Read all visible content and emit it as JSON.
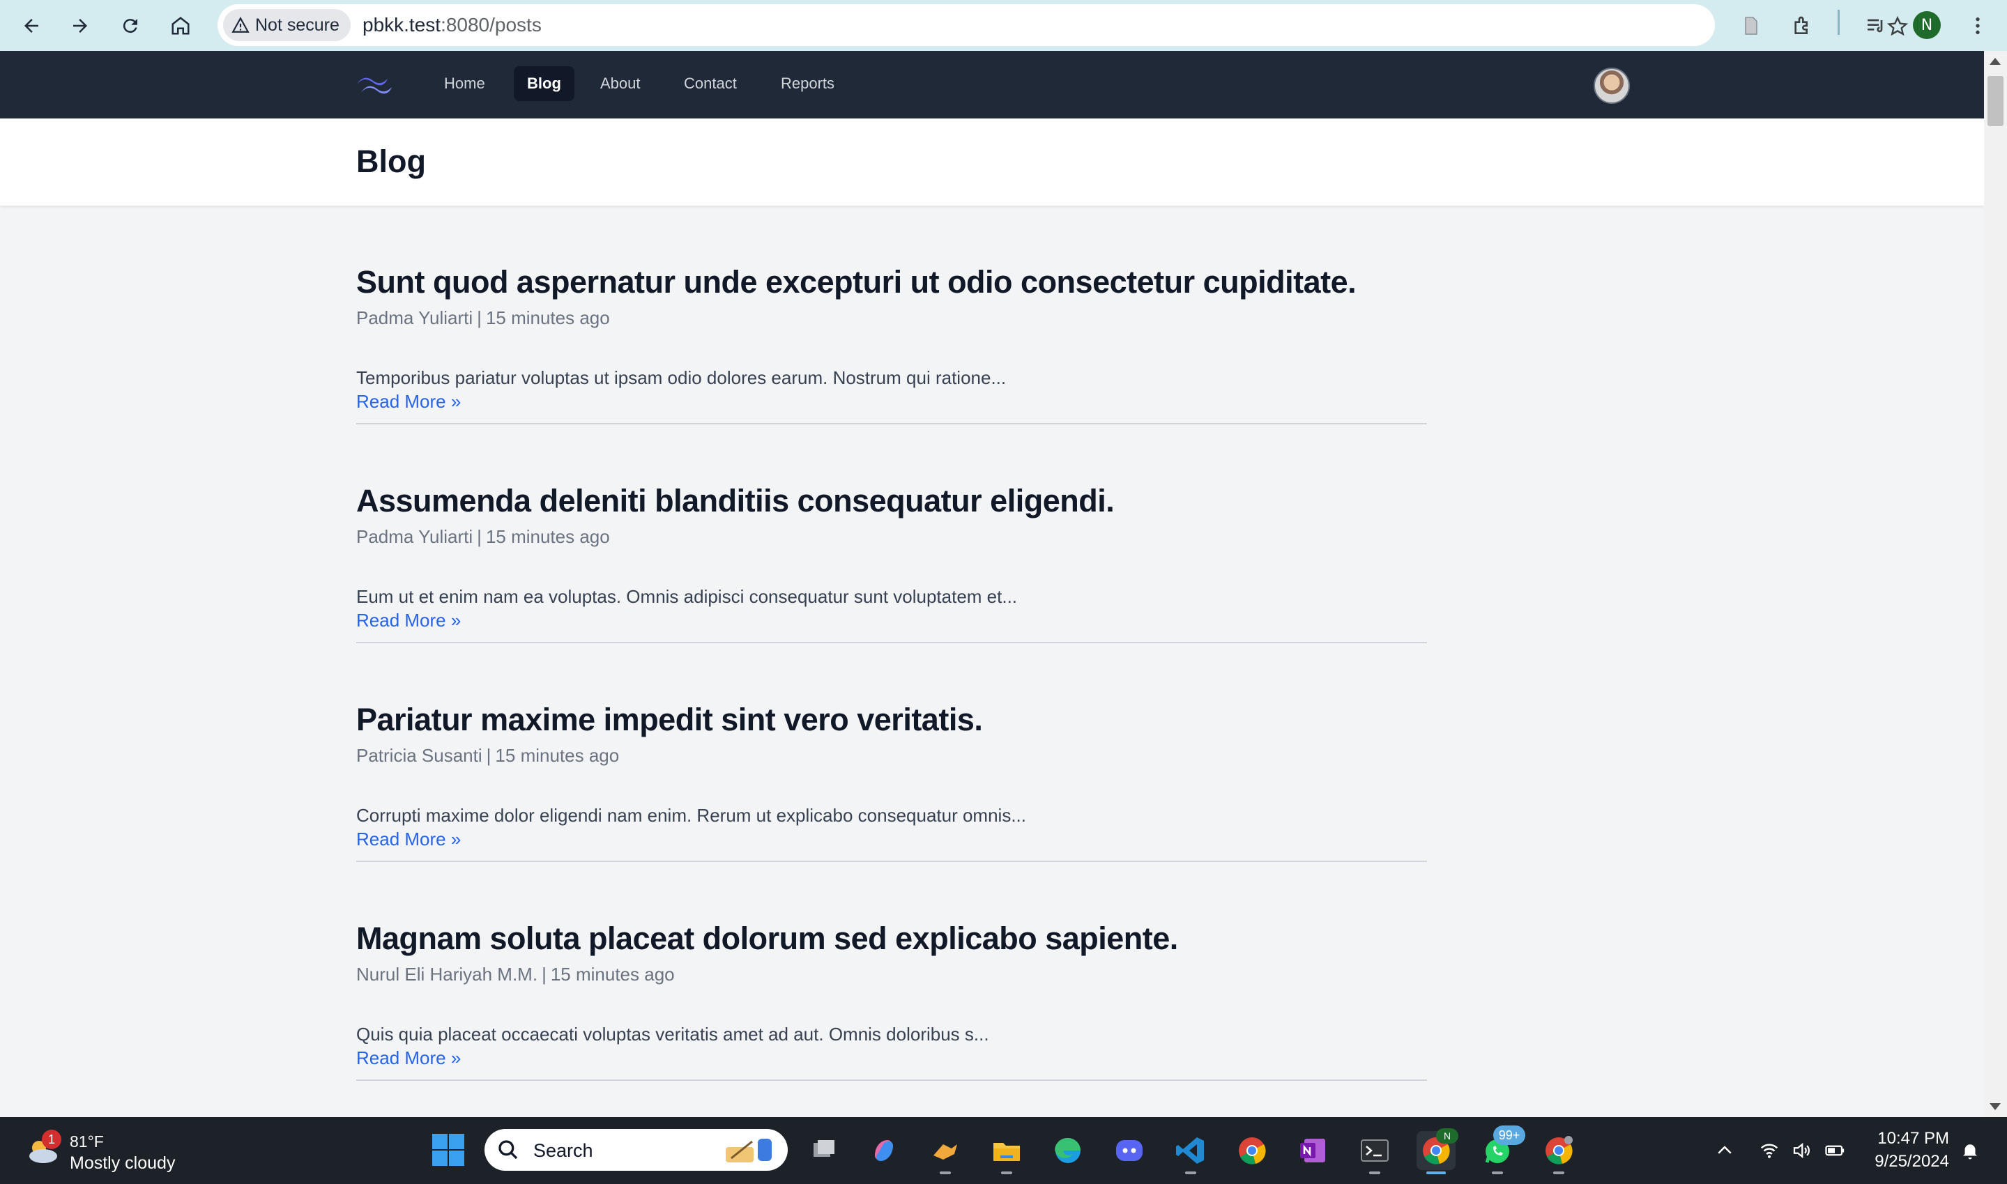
{
  "browser": {
    "security_label": "Not secure",
    "url_host": "pbkk.test",
    "url_rest": ":8080/posts"
  },
  "profile_initial": "N",
  "nav": {
    "items": [
      {
        "label": "Home",
        "active": false
      },
      {
        "label": "Blog",
        "active": true
      },
      {
        "label": "About",
        "active": false
      },
      {
        "label": "Contact",
        "active": false
      },
      {
        "label": "Reports",
        "active": false
      }
    ]
  },
  "page": {
    "title": "Blog"
  },
  "posts": [
    {
      "title": "Sunt quod aspernatur unde excepturi ut odio consectetur cupiditate.",
      "author": "Padma Yuliarti",
      "time": "15 minutes ago",
      "excerpt": "Temporibus pariatur voluptas ut ipsam odio dolores earum. Nostrum qui ratione...",
      "read_more": "Read More »"
    },
    {
      "title": "Assumenda deleniti blanditiis consequatur eligendi.",
      "author": "Padma Yuliarti",
      "time": "15 minutes ago",
      "excerpt": "Eum ut et enim nam ea voluptas. Omnis adipisci consequatur sunt voluptatem et...",
      "read_more": "Read More »"
    },
    {
      "title": "Pariatur maxime impedit sint vero veritatis.",
      "author": "Patricia Susanti",
      "time": "15 minutes ago",
      "excerpt": "Corrupti maxime dolor eligendi nam enim. Rerum ut explicabo consequatur omnis...",
      "read_more": "Read More »"
    },
    {
      "title": "Magnam soluta placeat dolorum sed explicabo sapiente.",
      "author": "Nurul Eli Hariyah M.M.",
      "time": "15 minutes ago",
      "excerpt": "Quis quia placeat occaecati voluptas veritatis amet ad aut. Omnis doloribus s...",
      "read_more": "Read More »"
    }
  ],
  "taskbar": {
    "weather_badge": "1",
    "weather_temp": "81°F",
    "weather_desc": "Mostly cloudy",
    "search_placeholder": "Search",
    "chrome_profile_badge": "N",
    "whatsapp_badge": "99+",
    "time": "10:47 PM",
    "date": "9/25/2024"
  },
  "colors": {
    "nav_bg": "#1f2937",
    "page_bg": "#f3f4f6",
    "link": "#2563eb",
    "browser_bar": "#d4ecef"
  }
}
